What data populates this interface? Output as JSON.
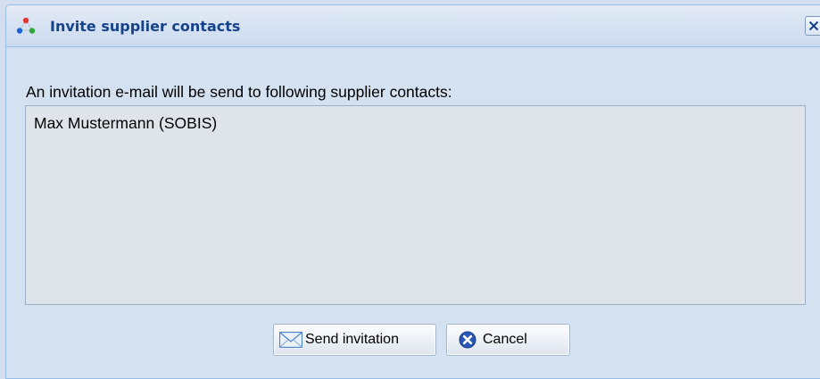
{
  "window": {
    "title": "Invite supplier contacts",
    "app_icon": "network-triangle-icon",
    "close_icon": "close-icon"
  },
  "body": {
    "intro_text": "An invitation e-mail will be send to following supplier contacts:",
    "contacts": [
      "Max Mustermann (SOBIS)"
    ]
  },
  "buttons": {
    "send_label": "Send invitation",
    "send_icon": "envelope-icon",
    "cancel_label": "Cancel",
    "cancel_icon": "cancel-circle-icon"
  },
  "colors": {
    "title_text": "#15428b",
    "panel_background": "#d3e1f1",
    "list_background": "#dfe3ea",
    "border": "#99bbe8"
  }
}
